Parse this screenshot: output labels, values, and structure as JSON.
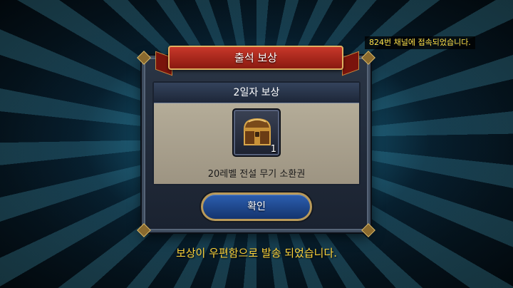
{
  "notification": {
    "channel": "824번 채널에 접속되었습니다."
  },
  "popup": {
    "title": "출석 보상",
    "subtitle": "2일자 보상",
    "reward": {
      "icon": "treasure-chest-icon",
      "count": "1",
      "name": "20레벨 전설 무기 소환권"
    },
    "confirm_label": "확인"
  },
  "footer": {
    "message": "보상이 우편함으로 발송 되었습니다."
  },
  "colors": {
    "ribbon": "#c8382a",
    "button": "#2c5fb0",
    "message": "#ffd43a"
  }
}
